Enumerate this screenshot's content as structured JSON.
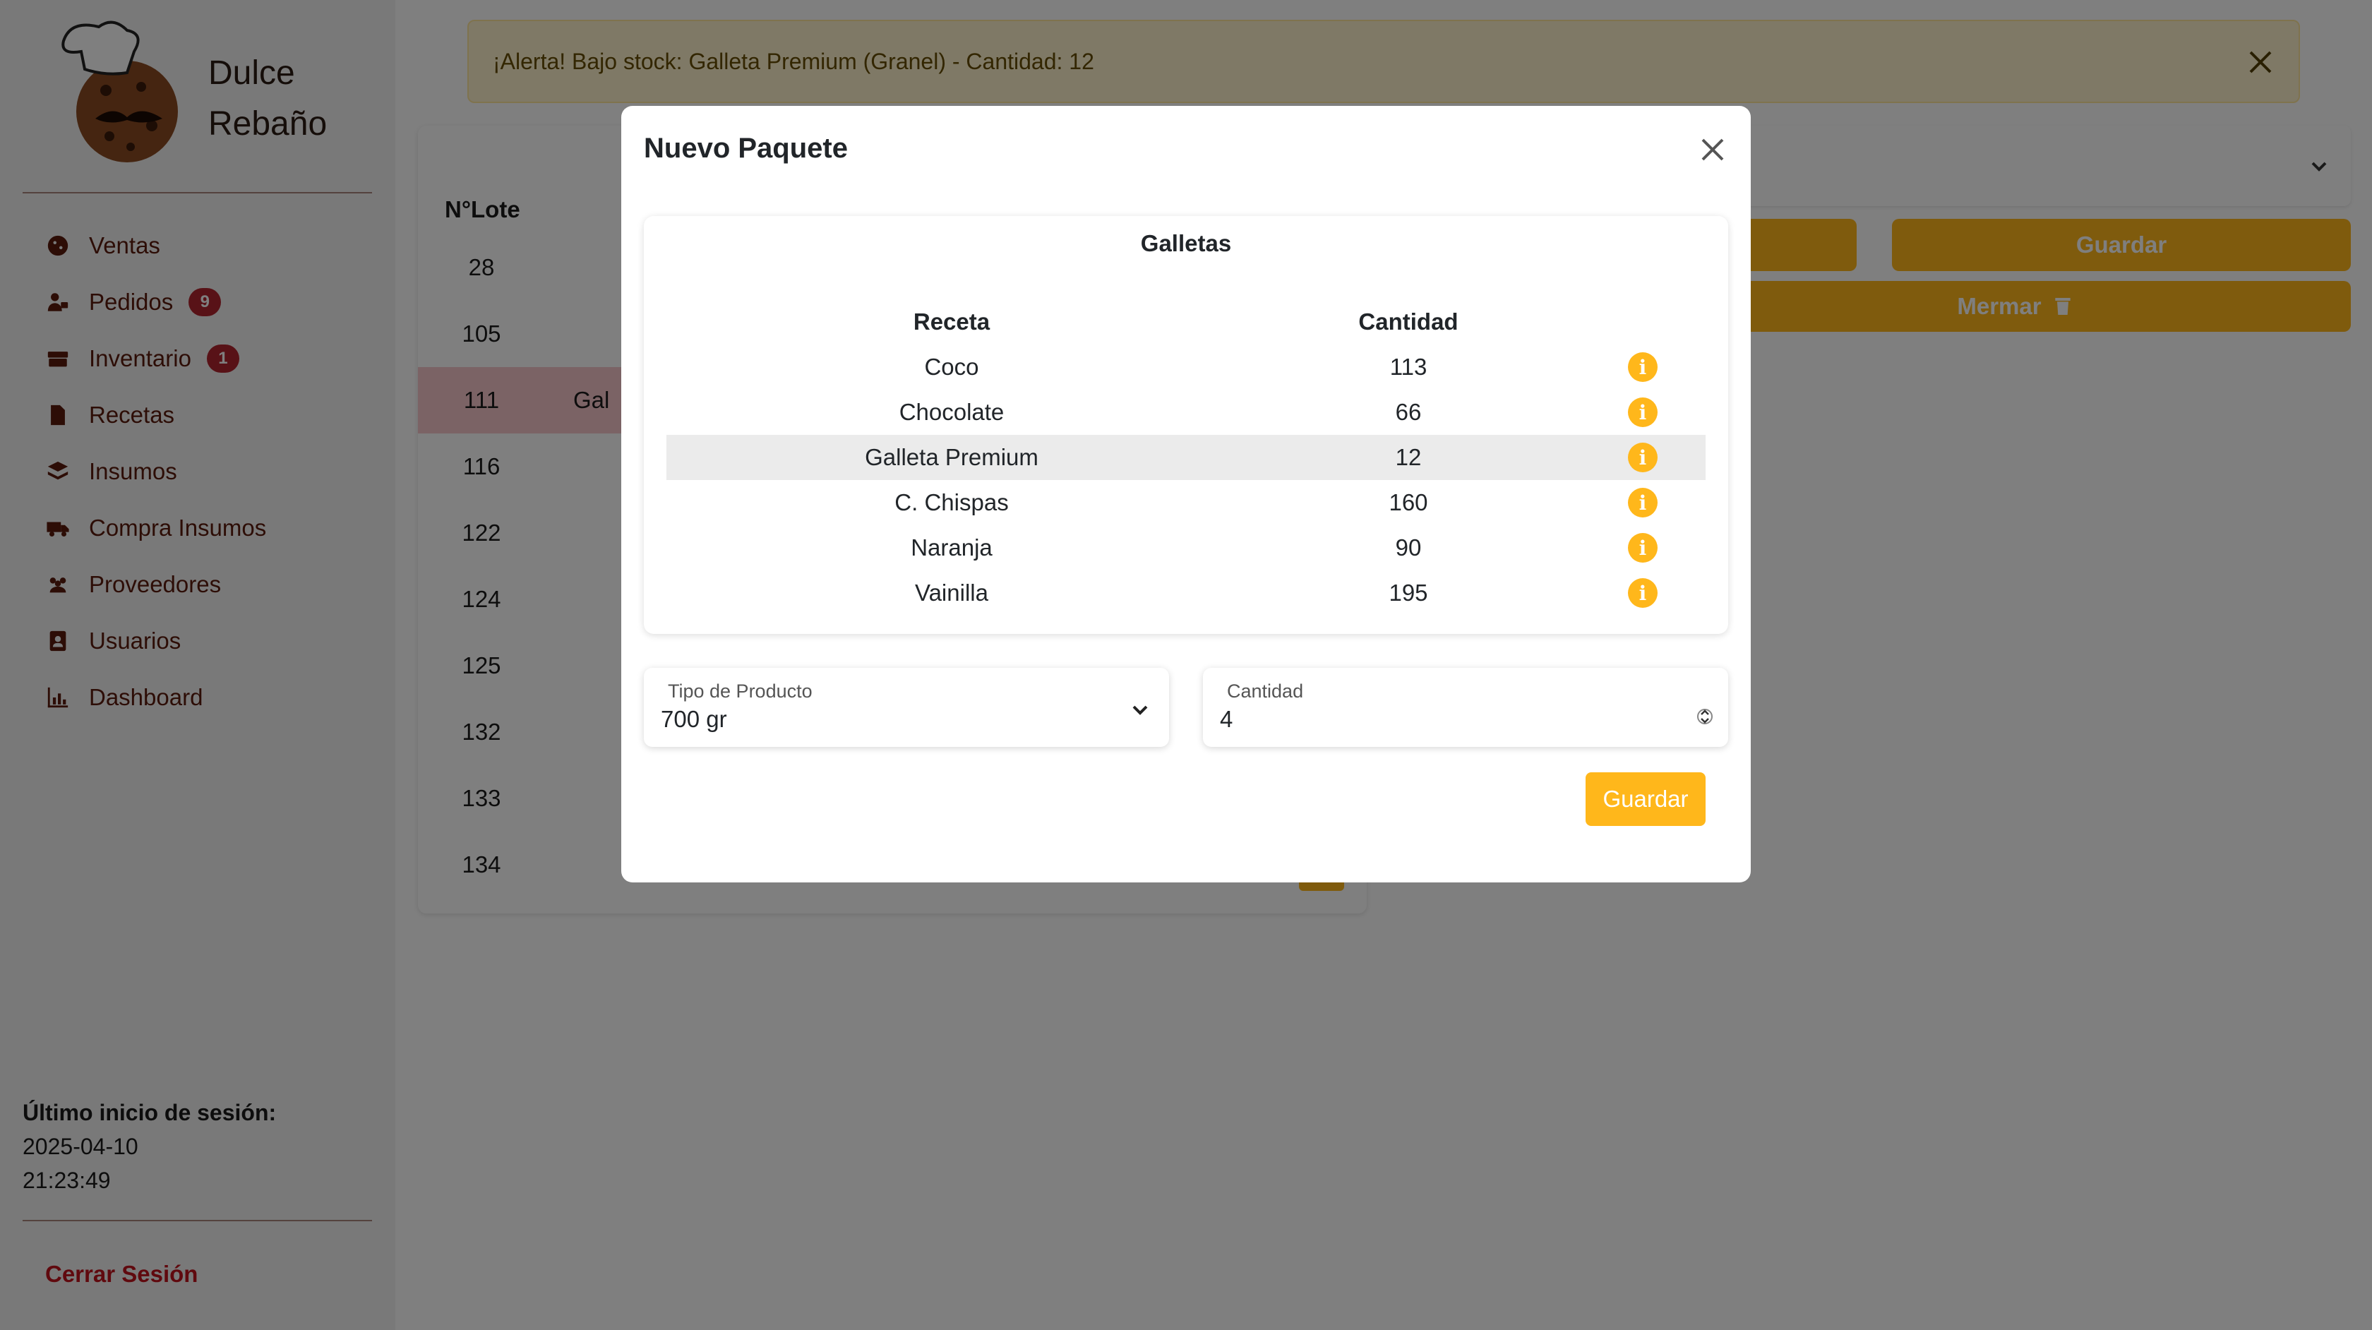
{
  "brand": {
    "line1": "Dulce",
    "line2": "Rebaño"
  },
  "sidebar": {
    "items": [
      {
        "label": "Ventas",
        "icon": "cookie-icon"
      },
      {
        "label": "Pedidos",
        "icon": "user-cart-icon",
        "badge": "9"
      },
      {
        "label": "Inventario",
        "icon": "boxes-icon",
        "badge": "1"
      },
      {
        "label": "Recetas",
        "icon": "file-icon"
      },
      {
        "label": "Insumos",
        "icon": "layers-icon"
      },
      {
        "label": "Compra Insumos",
        "icon": "truck-icon"
      },
      {
        "label": "Proveedores",
        "icon": "people-icon"
      },
      {
        "label": "Usuarios",
        "icon": "contact-book-icon"
      },
      {
        "label": "Dashboard",
        "icon": "chart-icon"
      }
    ],
    "last_login_label": "Último inicio de sesión:",
    "last_login_date": "2025-04-10",
    "last_login_time": "21:23:49",
    "logout_label": "Cerrar Sesión"
  },
  "alert": {
    "text": "¡Alerta! Bajo stock: Galleta Premium (Granel) - Cantidad: 12"
  },
  "lots": {
    "header": "N°Lote",
    "rows": [
      {
        "num": "28",
        "text": ""
      },
      {
        "num": "105",
        "text": ""
      },
      {
        "num": "111",
        "text": "Gal"
      },
      {
        "num": "116",
        "text": ""
      },
      {
        "num": "122",
        "text": ""
      },
      {
        "num": "124",
        "text": ""
      },
      {
        "num": "125",
        "text": ""
      },
      {
        "num": "132",
        "text": ""
      },
      {
        "num": "133",
        "text": ""
      },
      {
        "num": "134",
        "text": ""
      }
    ]
  },
  "right_panel": {
    "save_label": "Guardar",
    "waste_label": "Mermar"
  },
  "modal": {
    "title": "Nuevo Paquete",
    "card_title": "Galletas",
    "col_recipe": "Receta",
    "col_qty": "Cantidad",
    "rows": [
      {
        "recipe": "Coco",
        "qty": "113"
      },
      {
        "recipe": "Chocolate",
        "qty": "66"
      },
      {
        "recipe": "Galleta Premium",
        "qty": "12"
      },
      {
        "recipe": "C. Chispas",
        "qty": "160"
      },
      {
        "recipe": "Naranja",
        "qty": "90"
      },
      {
        "recipe": "Vainilla",
        "qty": "195"
      }
    ],
    "product_type_label": "Tipo de Producto",
    "product_type_value": "700 gr",
    "qty_label": "Cantidad",
    "qty_value": "4",
    "save_label": "Guardar"
  },
  "colors": {
    "accent": "#ffb71b",
    "brand_dark": "#5a1a0c",
    "badge": "#b0252f",
    "logout": "#c0121d"
  }
}
